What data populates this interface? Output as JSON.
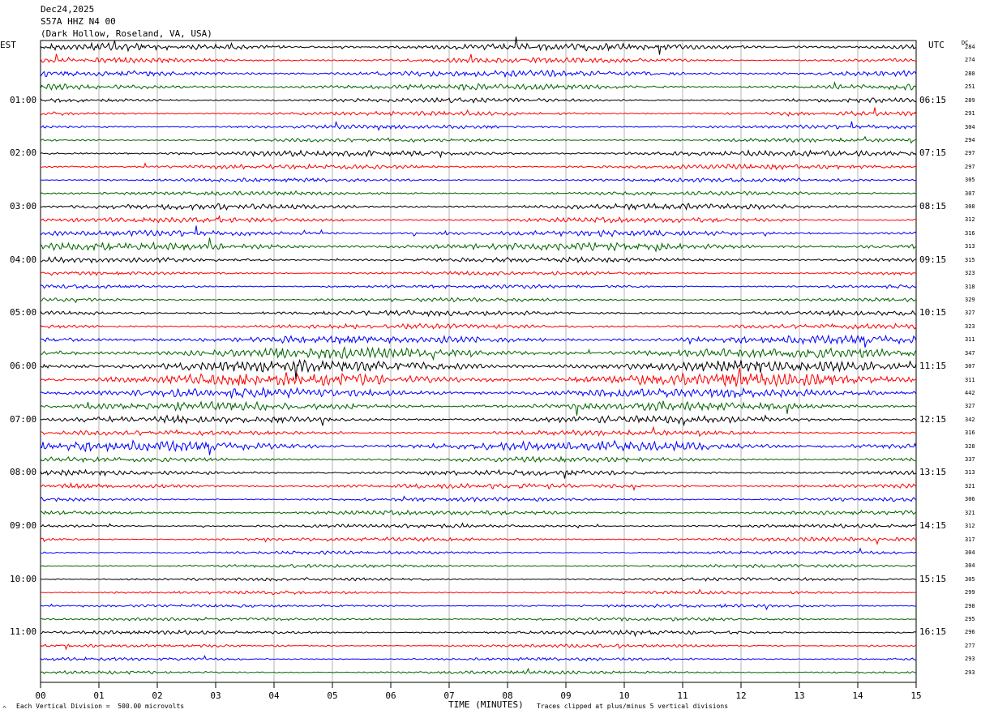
{
  "header": {
    "date": "Dec24,2025",
    "station": "S57A HHZ N4 00",
    "location": "(Dark Hollow, Roseland, VA, USA)"
  },
  "left_tz": "EST",
  "right_tz": "UTC",
  "dc_label": "DC",
  "footer": {
    "scale": "Each Vertical Division =  500.00 microvolts",
    "clip": "Traces clipped at plus/minus 5 vertical divisions",
    "corner_mark": "^"
  },
  "colors": {
    "trace": [
      "#000000",
      "#ff0000",
      "#0000ff",
      "#006400"
    ],
    "grid": "#808080"
  },
  "chart_data": {
    "type": "line",
    "title": "S57A HHZ N4 00",
    "xlabel": "TIME (MINUTES)",
    "xlim": [
      0,
      15
    ],
    "x_ticks": [
      "00",
      "01",
      "02",
      "03",
      "04",
      "05",
      "06",
      "07",
      "08",
      "09",
      "10",
      "11",
      "12",
      "13",
      "14",
      "15"
    ],
    "left_labels": [
      "01:00",
      "02:00",
      "03:00",
      "04:00",
      "05:00",
      "06:00",
      "07:00",
      "08:00",
      "09:00",
      "10:00",
      "11:00"
    ],
    "right_labels": [
      "06:15",
      "07:15",
      "08:15",
      "09:15",
      "10:15",
      "11:15",
      "12:15",
      "13:15",
      "14:15",
      "15:15",
      "16:15"
    ],
    "row_count": 48,
    "dc_offsets": [
      284,
      274,
      280,
      251,
      289,
      291,
      304,
      294,
      297,
      297,
      305,
      307,
      308,
      312,
      316,
      313,
      315,
      323,
      318,
      329,
      327,
      323,
      311,
      347,
      307,
      311,
      442,
      327,
      342,
      316,
      328,
      337,
      313,
      321,
      306,
      321,
      312,
      317,
      304,
      304,
      305,
      299,
      298,
      295,
      296,
      277,
      293,
      293
    ],
    "activity": [
      2.2,
      1.6,
      2.0,
      1.8,
      1.4,
      1.3,
      1.2,
      1.2,
      1.8,
      1.5,
      1.2,
      1.2,
      1.8,
      1.6,
      1.8,
      2.4,
      1.6,
      1.2,
      1.2,
      1.2,
      1.6,
      1.6,
      2.6,
      3.2,
      3.6,
      4.2,
      3.0,
      2.6,
      2.2,
      1.6,
      3.2,
      1.6,
      1.6,
      1.6,
      1.2,
      1.4,
      1.2,
      1.2,
      1.0,
      1.0,
      1.0,
      1.0,
      1.0,
      1.0,
      1.2,
      1.0,
      1.0,
      1.0
    ]
  }
}
